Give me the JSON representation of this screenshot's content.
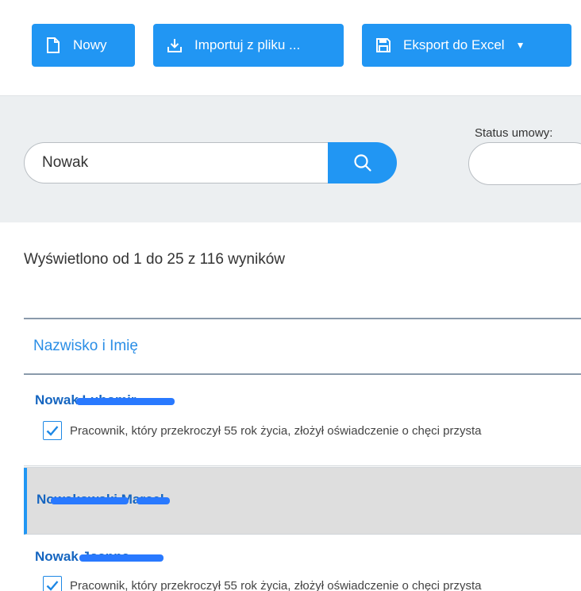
{
  "toolbar": {
    "new_label": "Nowy",
    "import_label": "Importuj z pliku ...",
    "export_label": "Eksport do Excel"
  },
  "filters": {
    "search_value": "Nowak",
    "status_label": "Status umowy:"
  },
  "results": {
    "summary": "Wyświetlono od 1 do 25 z 116 wyników"
  },
  "table": {
    "column_header": "Nazwisko i Imię",
    "rows": [
      {
        "name": "Nowak Lubomir",
        "note": "Pracownik, który przekroczył 55 rok życia, złożył oświadczenie o chęci przysta"
      },
      {
        "name": "Nowakowski Marcel"
      },
      {
        "name": "Nowak Joanna",
        "note": "Pracownik, który przekroczył 55 rok życia, złożył oświadczenie o chęci przysta"
      }
    ]
  },
  "colors": {
    "accent": "#2196f3",
    "link": "#1565c0",
    "panel": "#eceff1"
  }
}
